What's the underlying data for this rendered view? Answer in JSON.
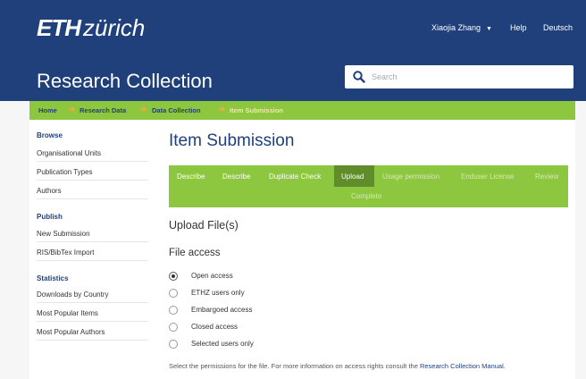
{
  "header": {
    "logo_eth": "ETH",
    "logo_zurich": "zürich",
    "site_title": "Research Collection",
    "user_name": "Xiaojia Zhang",
    "help": "Help",
    "language": "Deutsch",
    "search_placeholder": "Search"
  },
  "breadcrumb": [
    "Home",
    "Research Data",
    "Data Collection",
    "Item Submission"
  ],
  "sidebar": {
    "browse_heading": "Browse",
    "browse_items": [
      "Organisational Units",
      "Publication Types",
      "Authors"
    ],
    "publish_heading": "Publish",
    "publish_items": [
      "New Submission",
      "RIS/BibTex Import"
    ],
    "statistics_heading": "Statistics",
    "statistics_items": [
      "Downloads by Country",
      "Most Popular Items",
      "Most Popular Authors"
    ]
  },
  "main": {
    "title": "Item Submission",
    "steps": [
      "Describe",
      "Describe",
      "Duplicate Check",
      "Upload",
      "Usage permission",
      "Enduser License",
      "Review",
      "Complete"
    ],
    "active_step": "Upload",
    "upload_heading": "Upload File(s)",
    "file_access_heading": "File access",
    "access_options": [
      "Open access",
      "ETHZ users only",
      "Embargoed access",
      "Closed access",
      "Selected users only"
    ],
    "selected_option": "Open access",
    "help_text": "Select the permissions for the file. For more information on access rights consult the ",
    "help_link": "Research Collection Manual",
    "help_end": "."
  },
  "colors": {
    "header_bg": "#1f407a",
    "accent_green": "#8dc63f",
    "active_step": "#5e8d2a",
    "link_blue": "#1f407a"
  },
  "icons": [
    "search-icon",
    "caret-down-icon",
    "arrow-right-icon",
    "radio-icon"
  ]
}
